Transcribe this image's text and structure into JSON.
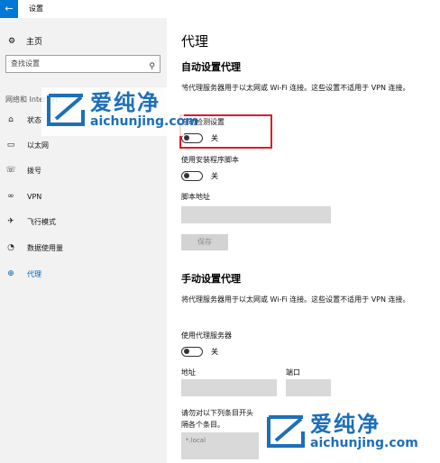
{
  "window": {
    "title": "设置",
    "back_glyph": "←"
  },
  "sidebar": {
    "home_label": "主页",
    "search_placeholder": "查找设置",
    "section_label": "网络和 Internet",
    "items": [
      {
        "id": "status",
        "label": "状态",
        "icon": "status-icon",
        "glyph": "⌂"
      },
      {
        "id": "ethernet",
        "label": "以太网",
        "icon": "ethernet-icon",
        "glyph": "▭"
      },
      {
        "id": "dialup",
        "label": "拨号",
        "icon": "dialup-icon",
        "glyph": "☏"
      },
      {
        "id": "vpn",
        "label": "VPN",
        "icon": "vpn-icon",
        "glyph": "∞"
      },
      {
        "id": "airplane",
        "label": "飞行模式",
        "icon": "airplane-icon",
        "glyph": "✈"
      },
      {
        "id": "datausage",
        "label": "数据使用量",
        "icon": "data-usage-icon",
        "glyph": "◔"
      },
      {
        "id": "proxy",
        "label": "代理",
        "icon": "proxy-icon",
        "glyph": "⊕",
        "active": true
      }
    ]
  },
  "main": {
    "title": "代理",
    "auto": {
      "heading": "自动设置代理",
      "description": "将代理服务器用于以太网或 Wi-Fi 连接。这些设置不适用于 VPN 连接。",
      "detect_label": "自动检测设置",
      "detect_state": "关",
      "script_label": "使用安装程序脚本",
      "script_state": "关",
      "address_label": "脚本地址",
      "save_label": "保存"
    },
    "manual": {
      "heading": "手动设置代理",
      "description": "将代理服务器用于以太网或 Wi-Fi 连接。这些设置不适用于 VPN 连接。",
      "use_proxy_label": "使用代理服务器",
      "use_proxy_state": "关",
      "address_label": "地址",
      "port_label": "端口",
      "exceptions_text_1": "请勿对以下列条目开头",
      "exceptions_text_2": "隔各个条目。",
      "exceptions_value": "*.local"
    }
  },
  "watermark": {
    "cn": "爱纯净",
    "en": "aichunjing.com",
    "color": "#1d6fb8"
  },
  "highlight_color": "#d81e2c"
}
